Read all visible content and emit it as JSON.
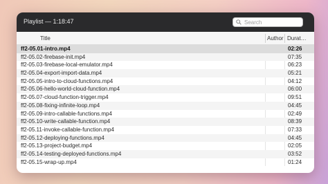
{
  "window": {
    "title": "Playlist — 1:18:47"
  },
  "search": {
    "placeholder": "Search",
    "icon": "search-icon"
  },
  "columns": {
    "title": "Title",
    "author": "Author",
    "duration": "Durat…"
  },
  "tracks": [
    {
      "title": "ff2-05.01-intro.mp4",
      "duration": "02:26",
      "selected": true
    },
    {
      "title": "ff2-05.02-firebase-init.mp4",
      "duration": "07:35"
    },
    {
      "title": "ff2-05.03-firebase-local-emulator.mp4",
      "duration": "06:23"
    },
    {
      "title": "ff2-05.04-export-import-data.mp4",
      "duration": "05:21"
    },
    {
      "title": "ff2-05.05-intro-to-cloud-functions.mp4",
      "duration": "04:12"
    },
    {
      "title": "ff2-05.06-hello-world-cloud-function.mp4",
      "duration": "06:00"
    },
    {
      "title": "ff2-05.07-cloud-function-trigger.mp4",
      "duration": "09:51"
    },
    {
      "title": "ff2-05.08-fixing-infinite-loop.mp4",
      "duration": "04:45"
    },
    {
      "title": "ff2-05.09-intro-callable-functions.mp4",
      "duration": "02:49"
    },
    {
      "title": "ff2-05.10-write-callable-function.mp4",
      "duration": "08:39"
    },
    {
      "title": "ff2-05.11-invoke-callable-function.mp4",
      "duration": "07:33"
    },
    {
      "title": "ff2-05.12-deploying-functions.mp4",
      "duration": "04:45"
    },
    {
      "title": "ff2-05.13-project-budget.mp4",
      "duration": "02:05"
    },
    {
      "title": "ff2-05.14-testing-deployed-functions.mp4",
      "duration": "03:52"
    },
    {
      "title": "ff2-05.15-wrap-up.mp4",
      "duration": "01:24"
    }
  ]
}
